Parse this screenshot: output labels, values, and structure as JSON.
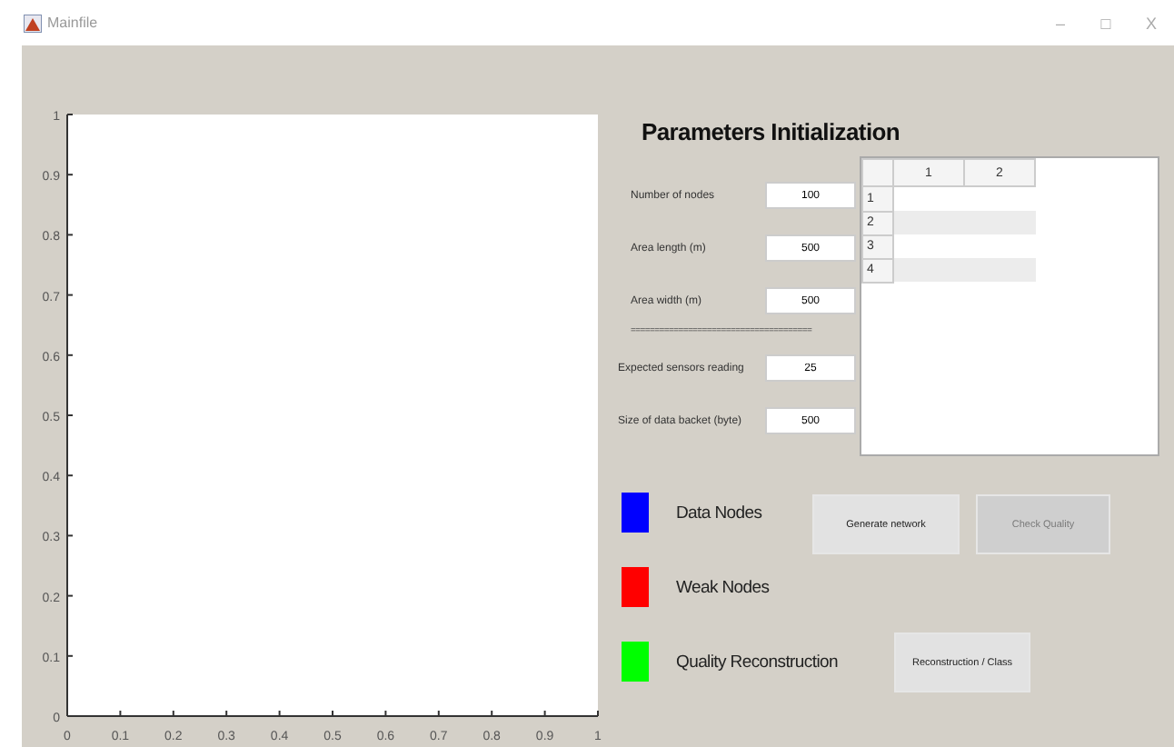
{
  "window": {
    "title": "Mainfile",
    "controls": [
      "–",
      "□",
      "X"
    ]
  },
  "plot": {
    "chart_data": {
      "type": "line",
      "xlim": [
        0,
        1
      ],
      "ylim": [
        0,
        1
      ],
      "xticks": [
        0,
        {
          "value": 0.1,
          "label": "0.1"
        },
        {
          "value": 0.2,
          "label": "0.2"
        },
        {
          "value": 0.3,
          "label": "0.3"
        },
        {
          "value": 0.4,
          "label": "0.4"
        },
        {
          "value": 0.5,
          "label": "0.5"
        },
        {
          "value": 0.6,
          "label": "0.6"
        },
        {
          "value": 0.7,
          "label": "0.7"
        },
        {
          "value": 0.8,
          "label": "0.8"
        },
        {
          "value": 0.9,
          "label": "0.9"
        },
        1
      ],
      "yticks": [
        0,
        {
          "value": 0.1,
          "label": "0.1"
        },
        {
          "value": 0.2,
          "label": "0.2"
        },
        {
          "value": 0.3,
          "label": "0.3"
        },
        {
          "value": 0.4,
          "label": "0.4"
        },
        {
          "value": 0.5,
          "label": "0.5"
        },
        {
          "value": 0.6,
          "label": "0.6"
        },
        {
          "value": 0.7,
          "label": "0.7"
        },
        {
          "value": 0.8,
          "label": "0.8"
        },
        {
          "value": 0.9,
          "label": "0.9"
        },
        1
      ]
    }
  },
  "panel": {
    "title": "Parameters Initialization",
    "fields": [
      {
        "kind": "field",
        "label": "Number of nodes",
        "value": "100"
      },
      {
        "kind": "field",
        "label": "Area length (m)",
        "value": "500"
      },
      {
        "kind": "field",
        "label": "Area width (m)",
        "value": "500"
      },
      {
        "kind": "separator",
        "label": "======================================"
      },
      {
        "kind": "field",
        "label": "Expected sensors reading",
        "value": "25"
      },
      {
        "kind": "field",
        "label": "Size of data backet (byte)",
        "value": "500"
      }
    ],
    "table": {
      "columns": [
        "1",
        "2"
      ],
      "rows": [
        "1",
        "2",
        "3",
        "4"
      ]
    }
  },
  "legend": [
    {
      "label": "Data Nodes",
      "color": "#0000ff"
    },
    {
      "label": "Weak Nodes",
      "color": "#ff0000"
    },
    {
      "label": "Quality Reconstruction",
      "color": "#00ff00"
    }
  ],
  "buttons": [
    {
      "label": "Generate network",
      "disabled": false
    },
    {
      "label": "Check Quality",
      "disabled": true
    },
    {
      "label": "Reconstruction / Class",
      "disabled": false
    }
  ]
}
